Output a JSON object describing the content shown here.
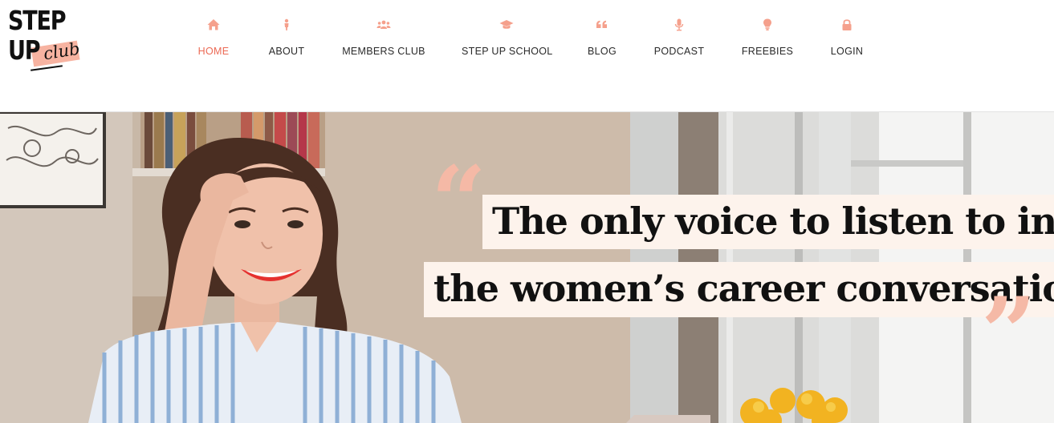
{
  "brand": {
    "logo_line1": "STEP",
    "logo_line2": "UP",
    "logo_script": "club",
    "accent_color": "#ec6a55",
    "logo_highlight_color": "#f7b3a1"
  },
  "nav": {
    "items": [
      {
        "label": "HOME",
        "icon": "home-icon",
        "active": true
      },
      {
        "label": "ABOUT",
        "icon": "person-icon"
      },
      {
        "label": "MEMBERS CLUB",
        "icon": "group-icon"
      },
      {
        "label": "STEP UP SCHOOL",
        "icon": "graduation-cap-icon"
      },
      {
        "label": "BLOG",
        "icon": "quote-icon"
      },
      {
        "label": "PODCAST",
        "icon": "microphone-icon"
      },
      {
        "label": "FREEBIES",
        "icon": "lightbulb-icon"
      },
      {
        "label": "LOGIN",
        "icon": "lock-icon"
      }
    ]
  },
  "hero": {
    "quote_open": "“",
    "quote_close": "”",
    "line1": "The only voice to listen to in",
    "line2": "the women’s career conversation."
  }
}
